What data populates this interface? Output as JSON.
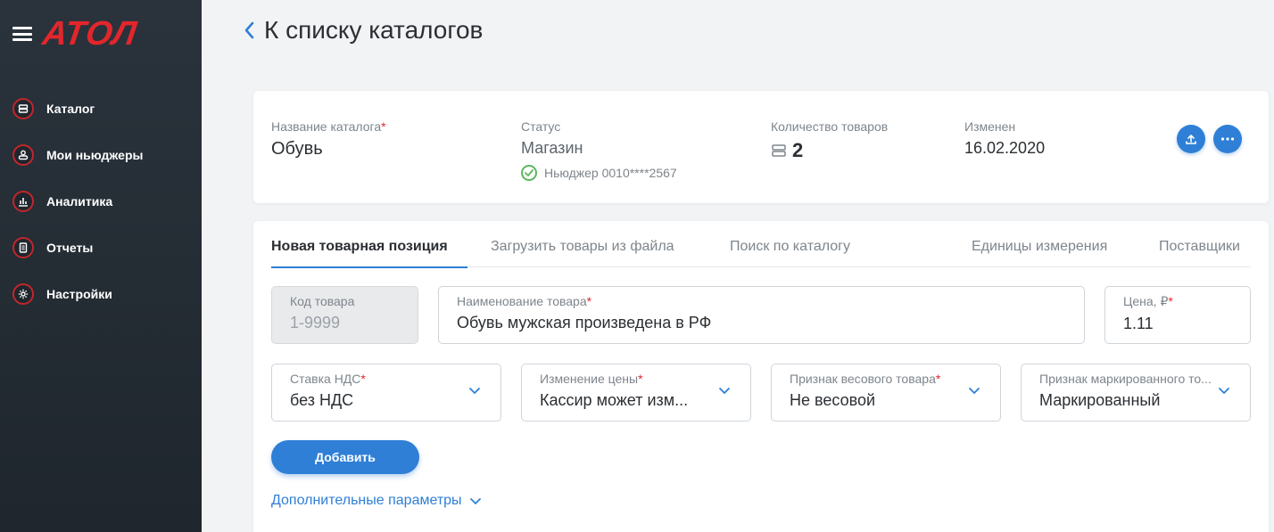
{
  "sidebar": {
    "logo": "АТОЛ",
    "items": [
      {
        "label": "Каталог",
        "icon": "catalog-icon"
      },
      {
        "label": "Мои ньюджеры",
        "icon": "user-icon"
      },
      {
        "label": "Аналитика",
        "icon": "chart-icon"
      },
      {
        "label": "Отчеты",
        "icon": "document-icon"
      },
      {
        "label": "Настройки",
        "icon": "gear-icon"
      }
    ]
  },
  "header": {
    "back_label": "К списку каталогов"
  },
  "catalog": {
    "name_label": "Название каталога",
    "name_value": "Обувь",
    "status_label": "Статус",
    "status_value": "Магазин",
    "status_sub": "Ньюджер 0010****2567",
    "count_label": "Количество товаров",
    "count_value": "2",
    "modified_label": "Изменен",
    "modified_value": "16.02.2020"
  },
  "tabs": [
    {
      "label": "Новая товарная позиция",
      "active": true
    },
    {
      "label": "Загрузить товары из файла",
      "active": false
    },
    {
      "label": "Поиск по каталогу",
      "active": false
    },
    {
      "label": "Единицы измерения",
      "active": false
    },
    {
      "label": "Поставщики",
      "active": false
    }
  ],
  "form": {
    "code": {
      "label": "Код товара",
      "value": "1-9999"
    },
    "name": {
      "label": "Наименование товара",
      "value": "Обувь мужская произведена в РФ"
    },
    "price": {
      "label": "Цена, ₽",
      "value": "1.11"
    },
    "vat": {
      "label": "Ставка НДС",
      "value": "без НДС"
    },
    "price_change": {
      "label": "Изменение цены",
      "value": "Кассир может изм..."
    },
    "weight": {
      "label": "Признак весового товара",
      "value": "Не весовой"
    },
    "marked": {
      "label": "Признак маркированного то...",
      "value": "Маркированный"
    },
    "add_label": "Добавить",
    "extra_label": "Дополнительные параметры",
    "required_mark": "*"
  },
  "colors": {
    "accent": "#2f7fd6",
    "brand": "#e2262c",
    "sidebar": "#262e36"
  }
}
